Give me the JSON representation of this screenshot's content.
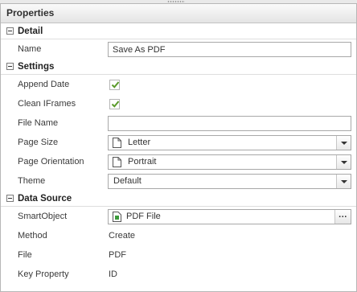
{
  "panel": {
    "title": "Properties"
  },
  "sections": {
    "detail": {
      "title": "Detail"
    },
    "settings": {
      "title": "Settings"
    },
    "data_source": {
      "title": "Data Source"
    }
  },
  "detail": {
    "name": {
      "label": "Name",
      "value": "Save As PDF"
    }
  },
  "settings": {
    "append_date": {
      "label": "Append Date",
      "checked": true
    },
    "clean_iframes": {
      "label": "Clean IFrames",
      "checked": true
    },
    "file_name": {
      "label": "File Name",
      "value": ""
    },
    "page_size": {
      "label": "Page Size",
      "selected": "Letter",
      "icon": "document-icon"
    },
    "page_orientation": {
      "label": "Page Orientation",
      "selected": "Portrait",
      "icon": "document-icon"
    },
    "theme": {
      "label": "Theme",
      "selected": "Default"
    }
  },
  "data_source": {
    "smartobject": {
      "label": "SmartObject",
      "value": "PDF File",
      "icon": "smartobject-icon",
      "browse_label": "..."
    },
    "method": {
      "label": "Method",
      "value": "Create"
    },
    "file": {
      "label": "File",
      "value": "PDF"
    },
    "key_property": {
      "label": "Key Property",
      "value": "ID"
    }
  },
  "colors": {
    "check": "#5a9a2a",
    "smartobject_icon": "#3c9a3c",
    "header_bg": "#e4e4e4"
  }
}
